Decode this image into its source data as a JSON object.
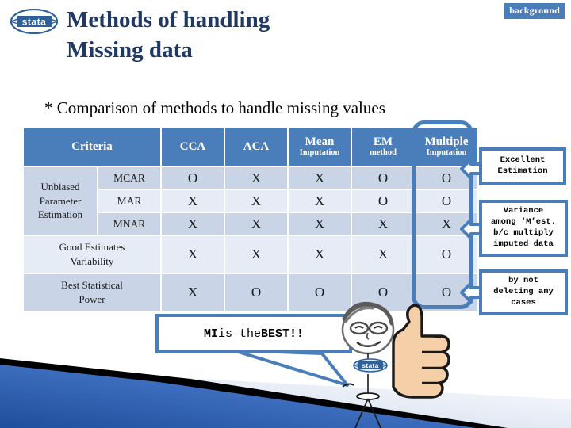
{
  "slide": {
    "title_lines": [
      "Methods of handling",
      "Missing data"
    ],
    "background_tag": "background",
    "subtitle": "* Comparison of methods to handle missing values",
    "logo_text": "stata",
    "accent_color": "#4a7ebb",
    "title_color": "#1f3864",
    "row_dark": "#c9d4e6",
    "row_light": "#e6ecf5"
  },
  "table": {
    "headers": [
      {
        "main": "Criteria",
        "sub": "",
        "span": 2
      },
      {
        "main": "CCA",
        "sub": ""
      },
      {
        "main": "ACA",
        "sub": ""
      },
      {
        "main": "Mean",
        "sub": "Imputation"
      },
      {
        "main": "EM",
        "sub": "method"
      },
      {
        "main": "Multiple",
        "sub": "Imputation"
      }
    ],
    "group_label": "Unbiased\nParameter\nEstimation",
    "rows": [
      {
        "sub": "MCAR",
        "values": [
          "O",
          "X",
          "X",
          "O",
          "O"
        ]
      },
      {
        "sub": "MAR",
        "values": [
          "X",
          "X",
          "X",
          "O",
          "O"
        ]
      },
      {
        "sub": "MNAR",
        "values": [
          "X",
          "X",
          "X",
          "X",
          "X"
        ]
      }
    ],
    "full_rows": [
      {
        "label": "Good Estimates\nVariability",
        "values": [
          "X",
          "X",
          "X",
          "X",
          "O"
        ]
      },
      {
        "label": "Best Statistical\nPower",
        "values": [
          "X",
          "O",
          "O",
          "O",
          "O"
        ]
      }
    ]
  },
  "callouts": [
    {
      "id": "callout1",
      "text": "Excellent\nEstimation"
    },
    {
      "id": "callout2",
      "text": "Variance\namong ‘M’est.\nb/c multiply\nimputed data"
    },
    {
      "id": "callout3",
      "text": "by not\ndeleting any\ncases"
    }
  ],
  "bubble": {
    "part1": "MI ",
    "part2": "is the ",
    "part3": "BEST!!"
  },
  "figure": {
    "logo_text": "stata"
  }
}
